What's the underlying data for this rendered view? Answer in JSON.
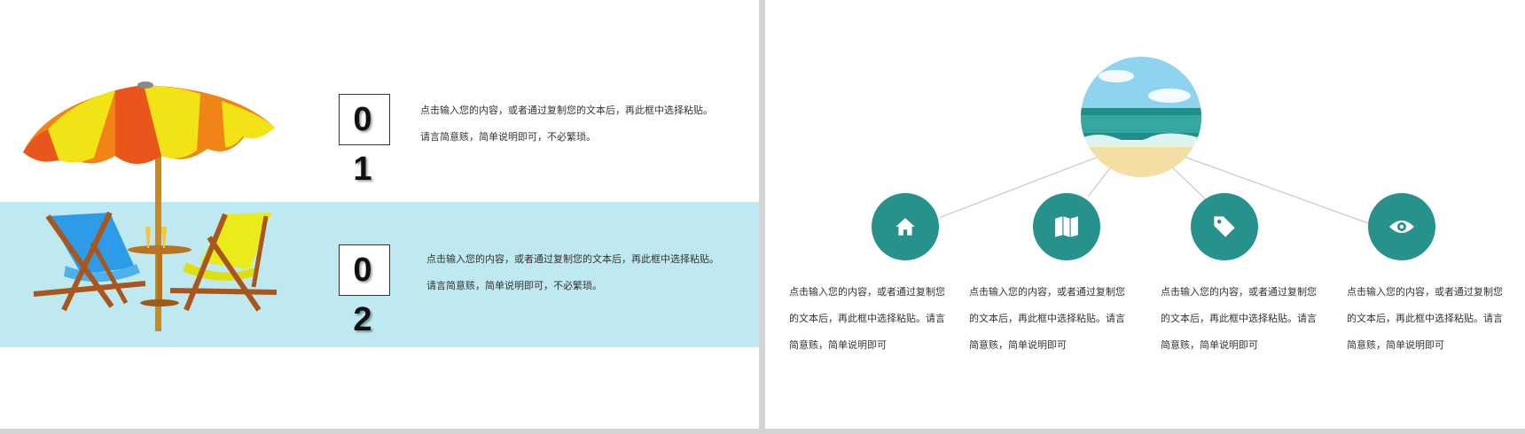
{
  "theme": {
    "band_color": "#bee9f0",
    "accent": "#27918c",
    "divider": "#d4d4d4"
  },
  "left_slide": {
    "items": [
      {
        "number": "0 1",
        "text": "点击输入您的内容，或者通过复制您的文本后，再此框中选择粘贴。请言简意赅，简单说明即可，不必繁琐。"
      },
      {
        "number": "0 2",
        "text": "点击输入您的内容，或者通过复制您的文本后，再此框中选择粘贴。请言简意赅，简单说明即可，不必繁琐。"
      }
    ]
  },
  "right_slide": {
    "features": [
      {
        "icon": "home-icon",
        "text": "点击输入您的内容，或者通过复制您的文本后，再此框中选择粘贴。请言简意赅，简单说明即可"
      },
      {
        "icon": "map-icon",
        "text": "点击输入您的内容，或者通过复制您的文本后，再此框中选择粘贴。请言简意赅，简单说明即可"
      },
      {
        "icon": "tag-icon",
        "text": "点击输入您的内容，或者通过复制您的文本后，再此框中选择粘贴。请言简意赅，简单说明即可"
      },
      {
        "icon": "eye-icon",
        "text": "点击输入您的内容，或者通过复制您的文本后，再此框中选择粘贴。请言简意赅，简单说明即可"
      }
    ]
  }
}
